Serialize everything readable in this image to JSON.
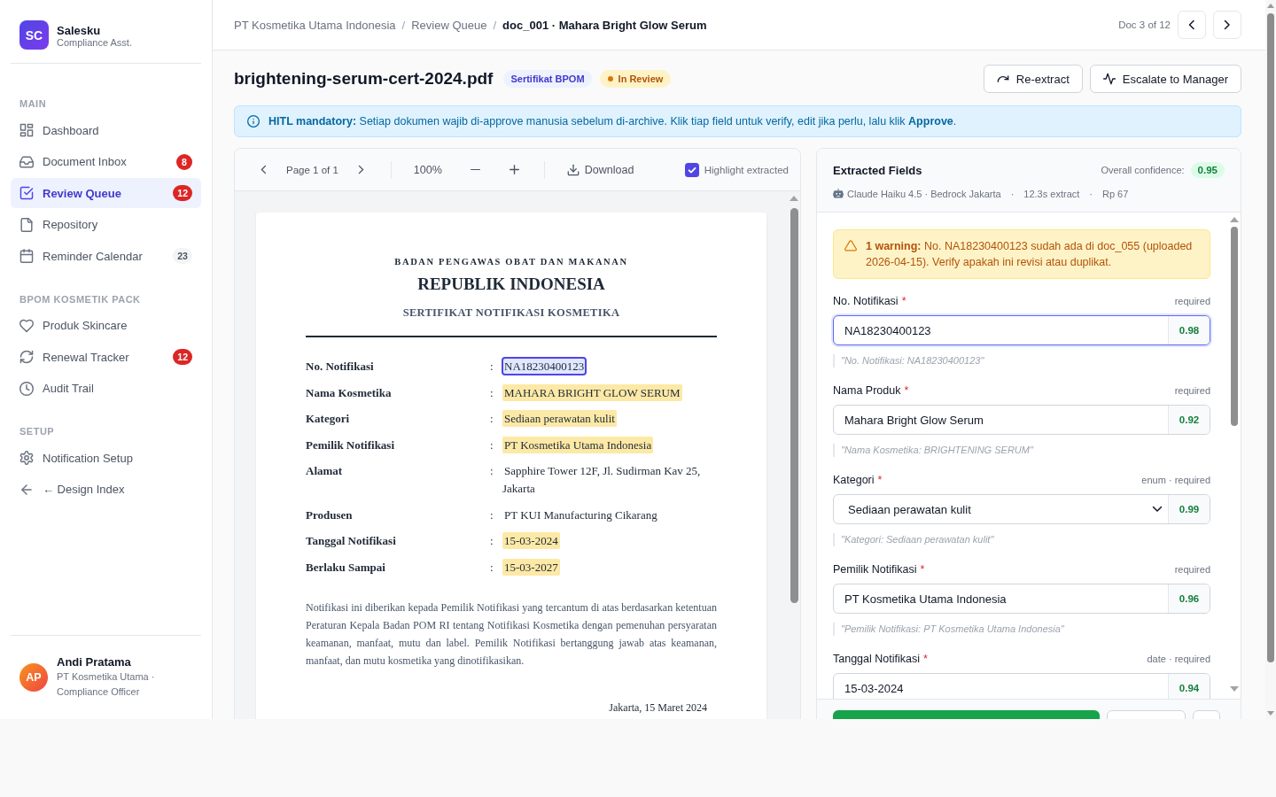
{
  "sidebar": {
    "brand": {
      "initials": "SC",
      "name": "Salesku",
      "subtitle": "Compliance Asst."
    },
    "sections": [
      {
        "title": "MAIN",
        "items": [
          {
            "label": "Dashboard",
            "selected": false
          },
          {
            "label": "Document Inbox",
            "selected": false,
            "badge": {
              "text": "8",
              "kind": "alert"
            }
          },
          {
            "label": "Review Queue",
            "selected": true,
            "badge": {
              "text": "12",
              "kind": "alert"
            }
          },
          {
            "label": "Repository",
            "selected": false
          },
          {
            "label": "Reminder Calendar",
            "selected": false,
            "badge": {
              "text": "23",
              "kind": "neutral"
            }
          }
        ]
      },
      {
        "title": "BPOM KOSMETIK PACK",
        "items": [
          {
            "label": "Produk Skincare",
            "selected": false
          },
          {
            "label": "Renewal Tracker",
            "selected": false,
            "badge": {
              "text": "12",
              "kind": "alert"
            }
          },
          {
            "label": "Audit Trail",
            "selected": false
          }
        ]
      },
      {
        "title": "SETUP",
        "items": [
          {
            "label": "Notification Setup",
            "selected": false
          },
          {
            "label": "← Design Index",
            "selected": false
          }
        ]
      }
    ],
    "user": {
      "initials": "AP",
      "name": "Andi Pratama",
      "detail": "PT Kosmetika Utama · Compliance Officer"
    }
  },
  "topbar": {
    "breadcrumb": [
      {
        "label": "PT Kosmetika Utama Indonesia",
        "current": false,
        "separator": "/"
      },
      {
        "label": "Review Queue",
        "current": false,
        "separator": "/"
      },
      {
        "label": "doc_001 · Mahara Bright Glow Serum",
        "current": true
      }
    ],
    "counter": "Doc 3 of 12"
  },
  "document_header": {
    "filename": "brightening-serum-cert-2024.pdf",
    "tags": [
      {
        "text": "Sertifikat BPOM",
        "kind": "type"
      },
      {
        "text": "In Review",
        "kind": "status"
      }
    ],
    "actions": [
      {
        "label": "Re-extract"
      },
      {
        "label": "Escalate to Manager"
      }
    ]
  },
  "banner": {
    "message": "**HITL mandatory:** Setiap dokumen wajib di-approve manusia sebelum di-archive. Klik tiap field untuk verify, edit jika perlu, lalu klik **Approve**."
  },
  "viewer": {
    "page": "Page 1 of 1",
    "zoom": "100%",
    "download": "Download",
    "highlight": {
      "label": "Highlight extracted",
      "checked": true
    },
    "document": {
      "agency": "BADAN PENGAWAS OBAT DAN MAKANAN",
      "country": "REPUBLIK INDONESIA",
      "title": "SERTIFIKAT NOTIFIKASI KOSMETIKA",
      "rows": [
        {
          "label": "No. Notifikasi",
          "separator": ":",
          "value": "NA18230400123",
          "highlighted": true,
          "selected": true
        },
        {
          "label": "Nama Kosmetika",
          "separator": ":",
          "value": "MAHARA BRIGHT GLOW SERUM",
          "highlighted": true,
          "selected": false
        },
        {
          "label": "Kategori",
          "separator": ":",
          "value": "Sediaan perawatan kulit",
          "highlighted": true,
          "selected": false
        },
        {
          "label": "Pemilik Notifikasi",
          "separator": ":",
          "value": "PT Kosmetika Utama Indonesia",
          "highlighted": true,
          "selected": false
        },
        {
          "label": "Alamat",
          "separator": ":",
          "value": "Sapphire Tower 12F, Jl. Sudirman Kav 25, Jakarta",
          "highlighted": false,
          "selected": false
        },
        {
          "label": "Produsen",
          "separator": ":",
          "value": "PT KUI Manufacturing Cikarang",
          "highlighted": false,
          "selected": false
        },
        {
          "label": "Tanggal Notifikasi",
          "separator": ":",
          "value": "15-03-2024",
          "highlighted": true,
          "selected": false
        },
        {
          "label": "Berlaku Sampai",
          "separator": ":",
          "value": "15-03-2027",
          "highlighted": true,
          "selected": false
        }
      ],
      "body": "Notifikasi ini diberikan kepada Pemilik Notifikasi yang tercantum di atas berdasarkan ketentuan Peraturan Kepala Badan POM RI tentang Notifikasi Kosmetika dengan pemenuhan persyaratan keamanan, manfaat, mutu dan label. Pemilik Notifikasi bertanggung jawab atas keamanan, manfaat, dan mutu kosmetika yang dinotifikasikan.",
      "place_date": "Jakarta, 15 Maret 2024"
    }
  },
  "extraction": {
    "title": "Extracted Fields",
    "confidence_label": "Overall confidence:",
    "confidence": "0.95",
    "meta": [
      {
        "text": "Claude Haiku 4.5 · Bedrock Jakarta"
      },
      {
        "separator": "·",
        "text": "12.3s extract"
      },
      {
        "separator": "·",
        "text": "Rp 67"
      }
    ],
    "warning": "**1 warning:** No. NA18230400123 sudah ada di doc_055 (uploaded 2026-04-15). Verify apakah ini revisi atau duplikat.",
    "fields": [
      {
        "label": "No. Notifikasi",
        "required_mark": "*",
        "hint": "required",
        "kind": "text",
        "value": "NA18230400123",
        "confidence": "0.98",
        "quote": "\"No. Notifikasi: NA18230400123\"",
        "selected": true
      },
      {
        "label": "Nama Produk",
        "required_mark": "*",
        "hint": "required",
        "kind": "text",
        "value": "Mahara Bright Glow Serum",
        "confidence": "0.92",
        "quote": "\"Nama Kosmetika: BRIGHTENING SERUM\"",
        "selected": false
      },
      {
        "label": "Kategori",
        "required_mark": "*",
        "hint": "enum · required",
        "kind": "select",
        "value": "Sediaan perawatan kulit",
        "confidence": "0.99",
        "quote": "\"Kategori: Sediaan perawatan kulit\"",
        "selected": false
      },
      {
        "label": "Pemilik Notifikasi",
        "required_mark": "*",
        "hint": "required",
        "kind": "text",
        "value": "PT Kosmetika Utama Indonesia",
        "confidence": "0.96",
        "quote": "\"Pemilik Notifikasi: PT Kosmetika Utama Indonesia\"",
        "selected": false
      },
      {
        "label": "Tanggal Notifikasi",
        "required_mark": "*",
        "hint": "date · required",
        "kind": "text",
        "value": "15-03-2024",
        "confidence": "0.94",
        "selected": false
      }
    ],
    "footer_buttons": [
      {
        "kind": "primary"
      },
      {
        "kind": "secondary"
      },
      {
        "kind": "secondary"
      }
    ]
  }
}
